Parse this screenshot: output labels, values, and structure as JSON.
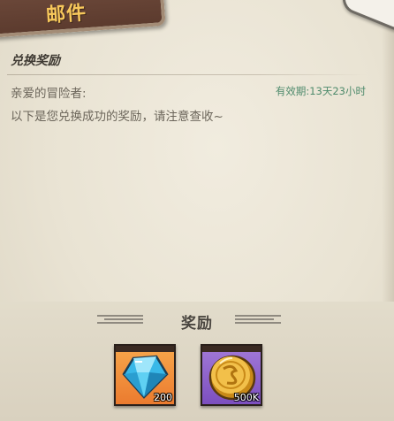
{
  "header": {
    "title": "邮件"
  },
  "mail": {
    "subject": "兑换奖励",
    "greeting": "亲爱的冒险者:",
    "validity_label": "有效期:",
    "validity_value": "13天23小时",
    "message": "以下是您兑换成功的奖励，请注意查收~"
  },
  "rewards": {
    "label": "奖励",
    "items": [
      {
        "icon": "diamond-icon",
        "quantity": "200"
      },
      {
        "icon": "gold-coin-icon",
        "quantity": "500K"
      }
    ]
  },
  "colors": {
    "tab_bg": "#5c3b2e",
    "tab_title": "#f7c85b",
    "validity_text": "#4d8a6b",
    "gem_frame": "#eb7b2f",
    "coin_frame": "#7c4fbf"
  }
}
